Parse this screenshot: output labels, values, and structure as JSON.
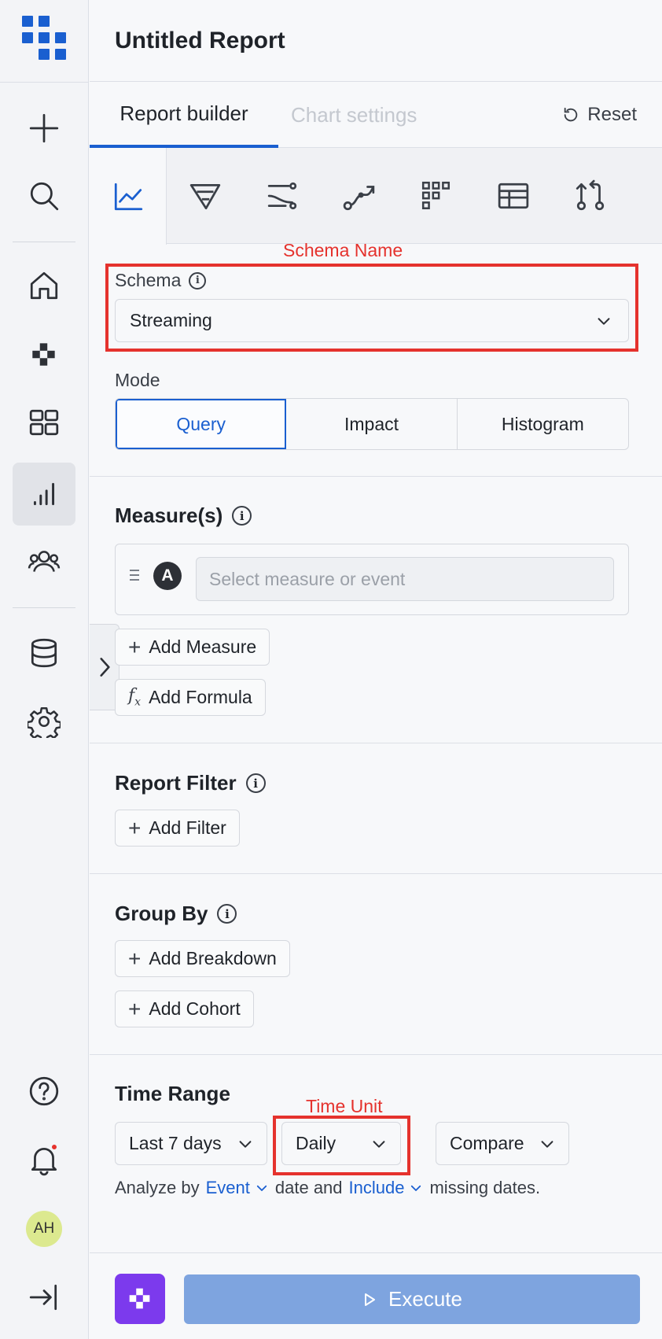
{
  "header": {
    "title": "Untitled Report"
  },
  "tabs": [
    {
      "label": "Report builder"
    },
    {
      "label": "Chart settings"
    }
  ],
  "reset_label": "Reset",
  "chart_types": [
    "line-chart-icon",
    "funnel-icon",
    "flows-icon",
    "journey-icon",
    "retention-grid-icon",
    "table-icon",
    "compare-icon"
  ],
  "annotations": {
    "schema_name": "Schema Name",
    "time_unit": "Time Unit"
  },
  "schema": {
    "label": "Schema",
    "value": "Streaming"
  },
  "mode": {
    "label": "Mode",
    "options": [
      "Query",
      "Impact",
      "Histogram"
    ],
    "selected": "Query"
  },
  "measures": {
    "title": "Measure(s)",
    "badge": "A",
    "placeholder": "Select measure or event",
    "add_measure": "Add Measure",
    "add_formula": "Add Formula"
  },
  "report_filter": {
    "title": "Report Filter",
    "add_filter": "Add Filter"
  },
  "group_by": {
    "title": "Group By",
    "add_breakdown": "Add Breakdown",
    "add_cohort": "Add Cohort"
  },
  "time_range": {
    "title": "Time Range",
    "range": "Last 7 days",
    "unit": "Daily",
    "compare": "Compare",
    "analyze_prefix": "Analyze by",
    "analyze_by": "Event",
    "analyze_mid": "date and",
    "missing_mode": "Include",
    "analyze_suffix": "missing dates."
  },
  "footer": {
    "execute_label": "Execute"
  },
  "user": {
    "initials": "AH"
  },
  "colors": {
    "accent": "#1a5fd0",
    "annotation": "#e5322d",
    "ai": "#7c3aed",
    "execute_disabled": "#7ea4df"
  }
}
